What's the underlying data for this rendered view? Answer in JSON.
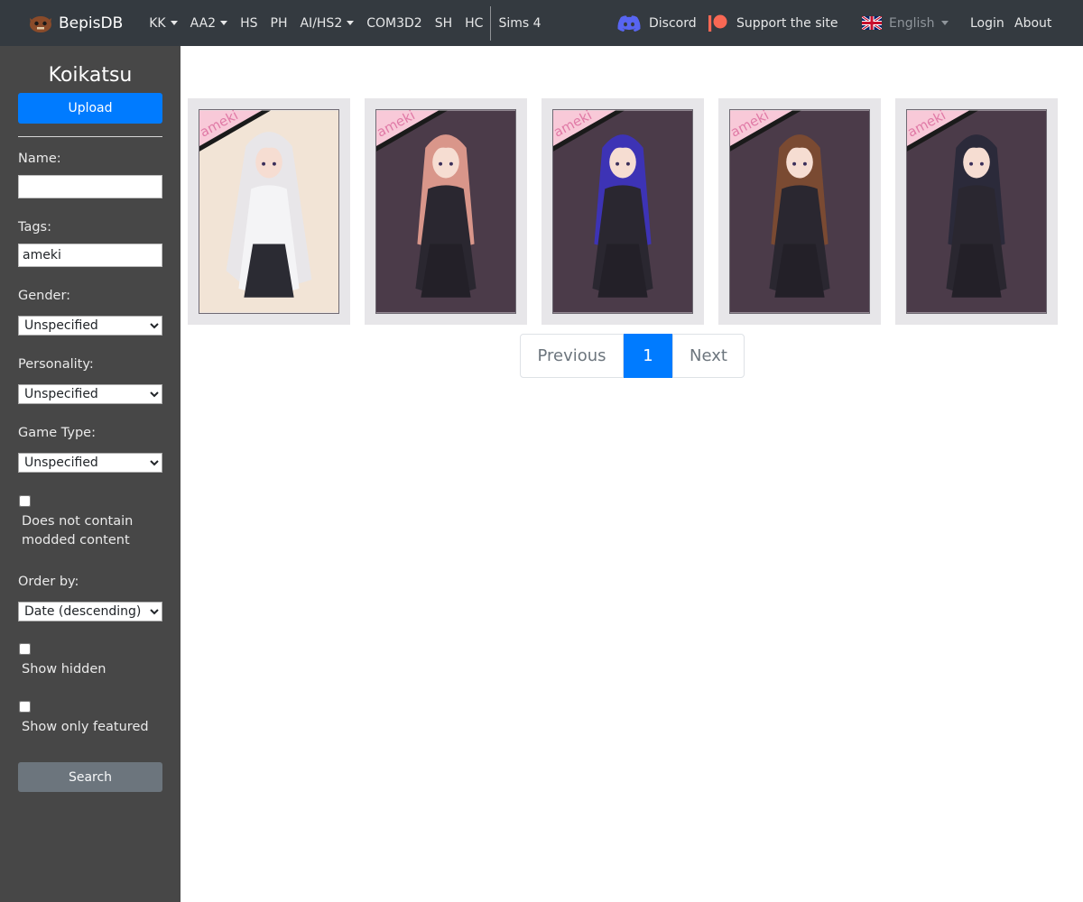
{
  "navbar": {
    "brand": "BepisDB",
    "items": [
      {
        "label": "KK",
        "dropdown": true
      },
      {
        "label": "AA2",
        "dropdown": true
      },
      {
        "label": "HS",
        "dropdown": false
      },
      {
        "label": "PH",
        "dropdown": false
      },
      {
        "label": "AI/HS2",
        "dropdown": true
      },
      {
        "label": "COM3D2",
        "dropdown": false
      },
      {
        "label": "SH",
        "dropdown": false
      },
      {
        "label": "HC",
        "dropdown": false
      },
      {
        "label": "Sims 4",
        "dropdown": false
      }
    ],
    "discord": "Discord",
    "support": "Support the site",
    "language": "English",
    "login": "Login",
    "about": "About"
  },
  "sidebar": {
    "title": "Koikatsu",
    "upload_label": "Upload",
    "name_label": "Name:",
    "name_value": "",
    "tags_label": "Tags:",
    "tags_value": "ameki",
    "gender_label": "Gender:",
    "gender_value": "Unspecified",
    "personality_label": "Personality:",
    "personality_value": "Unspecified",
    "game_type_label": "Game Type:",
    "game_type_value": "Unspecified",
    "no_mod_label": "Does not contain modded content",
    "order_label": "Order by:",
    "order_value": "Date (descending)",
    "show_hidden_label": "Show hidden",
    "show_featured_label": "Show only featured",
    "search_label": "Search"
  },
  "cards": [
    {
      "watermark": "ameki",
      "hair": "#e8e6e9",
      "bg": "#f2e4d6"
    },
    {
      "watermark": "ameki",
      "hair": "#d9968a",
      "bg": "#4b3b49"
    },
    {
      "watermark": "ameki",
      "hair": "#3d33b5",
      "bg": "#4b3b49"
    },
    {
      "watermark": "ameki",
      "hair": "#7a4a32",
      "bg": "#4b3b49"
    },
    {
      "watermark": "ameki",
      "hair": "#2b2a3a",
      "bg": "#4b3b49"
    }
  ],
  "pagination": {
    "previous": "Previous",
    "current": "1",
    "next": "Next"
  },
  "colors": {
    "navbar": "#343a40",
    "sidebar": "#474747",
    "primary": "#007bff",
    "secondary": "#6c757d",
    "discord": "#5865f2",
    "patreon": "#f96854"
  }
}
